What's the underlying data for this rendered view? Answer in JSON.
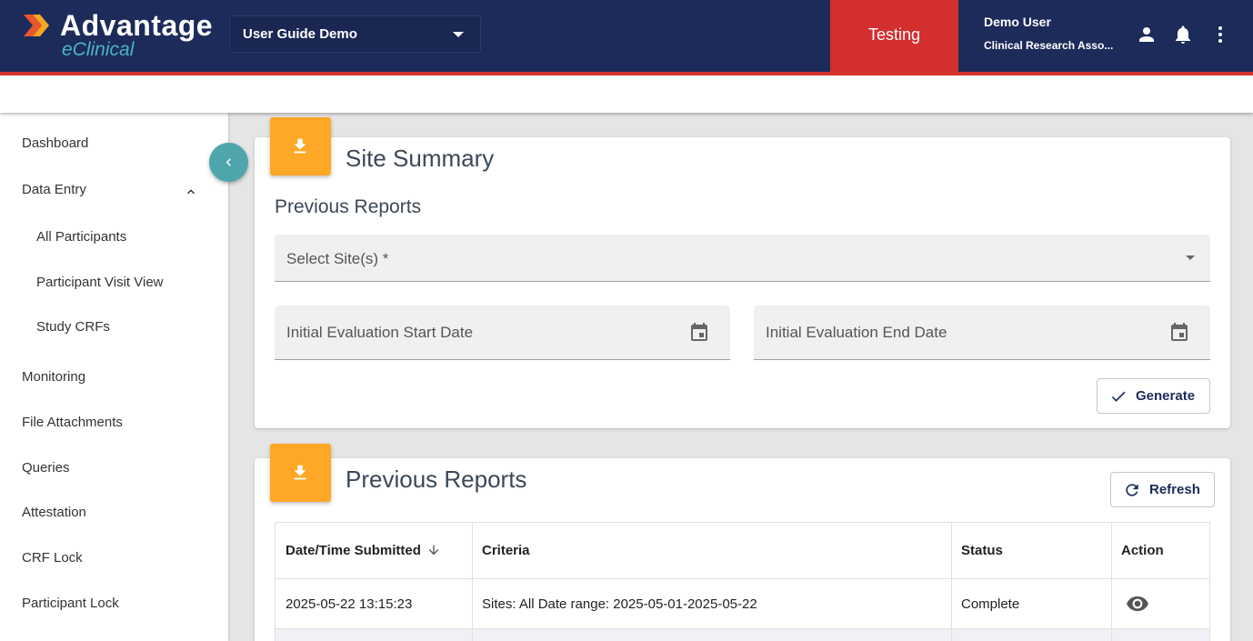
{
  "header": {
    "logo_title": "Advantage",
    "logo_subtitle": "eClinical",
    "study_selector": "User Guide Demo",
    "environment": "Testing",
    "user_name": "Demo User",
    "user_role": "Clinical Research Asso...",
    "colors": {
      "bar": "#1d2b5a",
      "accent": "#d63231",
      "env_badge": "#d32f2f",
      "logo_sub": "#4ab5c4"
    }
  },
  "sidebar": {
    "items": [
      {
        "label": "Dashboard"
      },
      {
        "label": "Data Entry",
        "expanded": true
      },
      {
        "label": "All Participants"
      },
      {
        "label": "Participant Visit View"
      },
      {
        "label": "Study CRFs"
      },
      {
        "label": "Monitoring"
      },
      {
        "label": "File Attachments"
      },
      {
        "label": "Queries"
      },
      {
        "label": "Attestation"
      },
      {
        "label": "CRF Lock"
      },
      {
        "label": "Participant Lock"
      }
    ]
  },
  "site_summary": {
    "title": "Site Summary",
    "section_label": "Previous Reports",
    "site_select_placeholder": "Select Site(s) *",
    "start_date_placeholder": "Initial Evaluation Start Date",
    "end_date_placeholder": "Initial Evaluation End Date",
    "generate_label": "Generate"
  },
  "previous_reports": {
    "title": "Previous Reports",
    "refresh_label": "Refresh",
    "columns": [
      "Date/Time Submitted",
      "Criteria",
      "Status",
      "Action"
    ],
    "rows": [
      {
        "submitted": "2025-05-22 13:15:23",
        "criteria": "Sites: All Date range: 2025-05-01-2025-05-22",
        "status": "Complete",
        "action_icon": "eye-icon"
      }
    ]
  },
  "icons": {
    "card_icon": "download-icon",
    "card_icon_color": "#ffa726",
    "collapse_button_color": "#4ea6ac"
  }
}
